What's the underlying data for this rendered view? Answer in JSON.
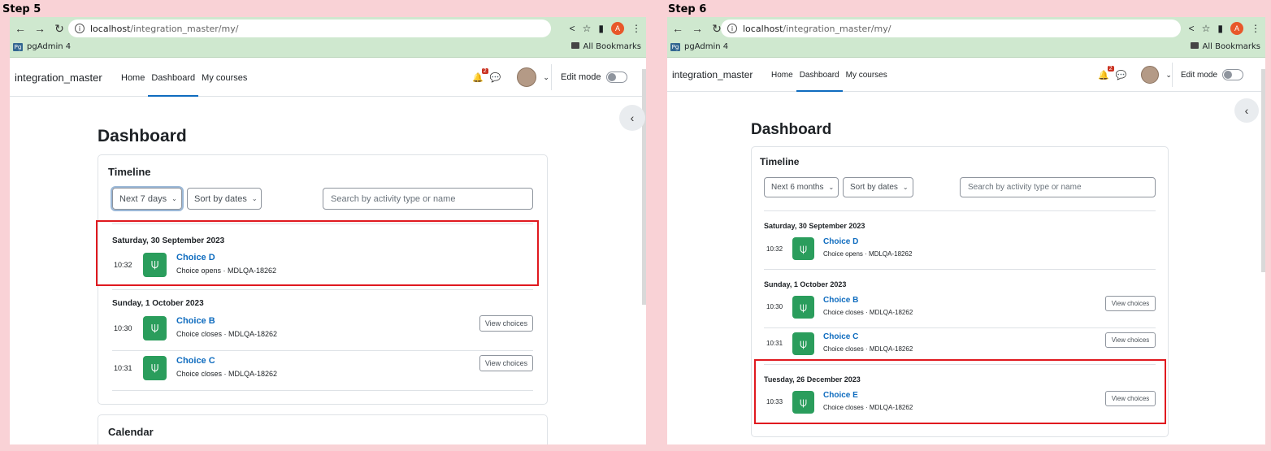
{
  "steps": [
    {
      "label": "Step 5",
      "browser": {
        "url_host": "localhost",
        "url_path": "/integration_master/my/",
        "bookmark": "pgAdmin 4",
        "all_bookmarks": "All Bookmarks",
        "profile_initial": "A"
      },
      "site_name": "integration_master",
      "nav": [
        "Home",
        "Dashboard",
        "My courses"
      ],
      "notif_count": "2",
      "edit_mode": "Edit mode",
      "page_title": "Dashboard",
      "timeline_title": "Timeline",
      "filter": "Next 7 days",
      "sort": "Sort by dates",
      "search_placeholder": "Search by activity type or name",
      "groups": [
        {
          "date": "Saturday, 30 September 2023",
          "events": [
            {
              "time": "10:32",
              "name": "Choice D",
              "sub": "Choice opens · MDLQA-18262",
              "button": ""
            }
          ]
        },
        {
          "date": "Sunday, 1 October 2023",
          "events": [
            {
              "time": "10:30",
              "name": "Choice B",
              "sub": "Choice closes · MDLQA-18262",
              "button": "View choices"
            },
            {
              "time": "10:31",
              "name": "Choice C",
              "sub": "Choice closes · MDLQA-18262",
              "button": "View choices"
            }
          ]
        }
      ],
      "calendar_title": "Calendar"
    },
    {
      "label": "Step 6",
      "browser": {
        "url_host": "localhost",
        "url_path": "/integration_master/my/",
        "bookmark": "pgAdmin 4",
        "all_bookmarks": "All Bookmarks",
        "profile_initial": "A"
      },
      "site_name": "integration_master",
      "nav": [
        "Home",
        "Dashboard",
        "My courses"
      ],
      "notif_count": "2",
      "edit_mode": "Edit mode",
      "page_title": "Dashboard",
      "timeline_title": "Timeline",
      "filter": "Next 6 months",
      "sort": "Sort by dates",
      "search_placeholder": "Search by activity type or name",
      "groups": [
        {
          "date": "Saturday, 30 September 2023",
          "events": [
            {
              "time": "10:32",
              "name": "Choice D",
              "sub": "Choice opens · MDLQA-18262",
              "button": ""
            }
          ]
        },
        {
          "date": "Sunday, 1 October 2023",
          "events": [
            {
              "time": "10:30",
              "name": "Choice B",
              "sub": "Choice closes · MDLQA-18262",
              "button": "View choices"
            },
            {
              "time": "10:31",
              "name": "Choice C",
              "sub": "Choice closes · MDLQA-18262",
              "button": "View choices"
            }
          ]
        },
        {
          "date": "Tuesday, 26 December 2023",
          "events": [
            {
              "time": "10:33",
              "name": "Choice E",
              "sub": "Choice closes · MDLQA-18262",
              "button": "View choices"
            }
          ]
        }
      ]
    }
  ],
  "icons": {
    "back": "arrow-left-icon",
    "forward": "arrow-right-icon",
    "reload": "reload-icon",
    "choice": "choice-activity-icon",
    "bell": "bell-icon",
    "chat": "chat-icon",
    "chevron": "chevron-left-icon"
  },
  "colors": {
    "highlight": "#e0191f",
    "link": "#0f6cbf",
    "activity": "#2a9d5c",
    "chrome": "#cfe8cf"
  }
}
